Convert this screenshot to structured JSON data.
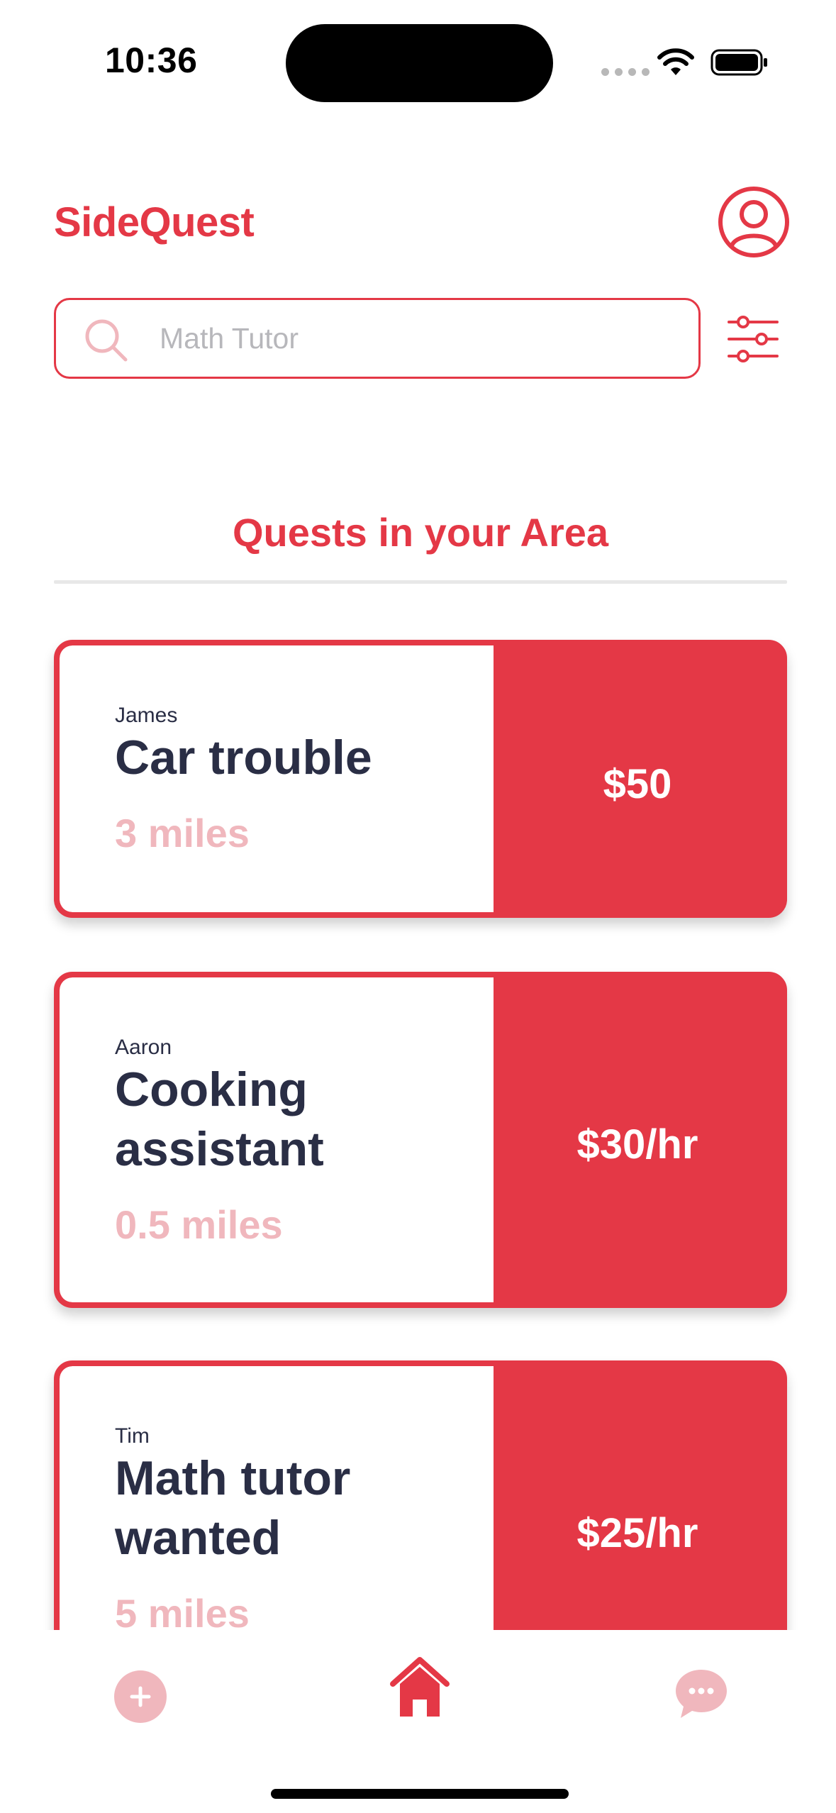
{
  "status_bar": {
    "time": "10:36"
  },
  "header": {
    "brand": "SideQuest"
  },
  "search": {
    "placeholder": "Math Tutor",
    "value": ""
  },
  "section": {
    "title": "Quests in your Area"
  },
  "quests": [
    {
      "poster": "James",
      "title": "Car trouble",
      "distance": "3 miles",
      "price": "$50"
    },
    {
      "poster": "Aaron",
      "title": "Cooking assistant",
      "distance": "0.5 miles",
      "price": "$30/hr"
    },
    {
      "poster": "Tim",
      "title": "Math tutor wanted",
      "distance": "5 miles",
      "price": "$25/hr"
    }
  ],
  "tabbar": {
    "active": "home",
    "items": [
      "add-icon",
      "home-icon",
      "chat-icon"
    ]
  },
  "colors": {
    "accent": "#e43846",
    "accent_light": "#f0b7bd",
    "text_dark": "#2a2e45",
    "divider": "#e8e8e8"
  }
}
